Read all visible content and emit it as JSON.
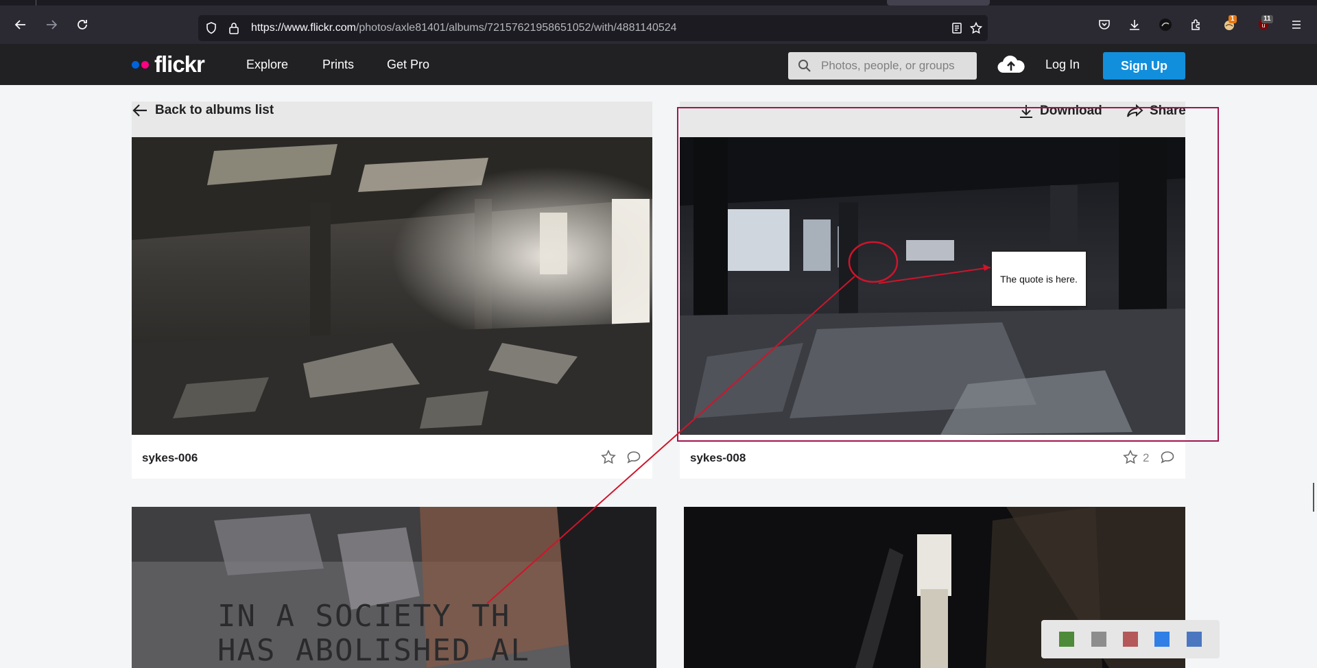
{
  "browser": {
    "url_host": "https://www.flickr.com",
    "url_path": "/photos/axle81401/albums/72157621958651052/with/4881140524",
    "extension_badge_1": "1",
    "extension_badge_2": "11"
  },
  "flickr": {
    "brand": "flickr",
    "brand_colors": {
      "blue": "#0063dc",
      "pink": "#ff0084"
    },
    "nav": [
      "Explore",
      "Prints",
      "Get Pro"
    ],
    "search_placeholder": "Photos, people, or groups",
    "login": "Log In",
    "signup": "Sign Up"
  },
  "page": {
    "back_label": "Back to albums list",
    "download_label": "Download",
    "share_label": "Share"
  },
  "photos": [
    {
      "title": "sykes-006",
      "faves": ""
    },
    {
      "title": "sykes-008",
      "faves": "2"
    }
  ],
  "annotation": {
    "note": "The quote is here.",
    "color": "#d0142b"
  },
  "mural_text": [
    "IN A SOCIETY TH",
    "HAS ABOLISHED AL"
  ]
}
